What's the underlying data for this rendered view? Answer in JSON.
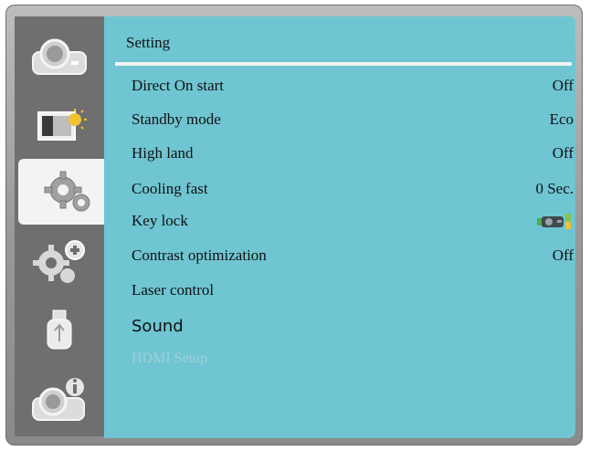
{
  "sidebar": {
    "items": [
      {
        "icon": "projector-icon"
      },
      {
        "icon": "image-adjust-icon"
      },
      {
        "icon": "settings-gears-icon",
        "active": true
      },
      {
        "icon": "advanced-settings-icon"
      },
      {
        "icon": "usb-icon"
      },
      {
        "icon": "projector-info-icon"
      }
    ]
  },
  "panel": {
    "title": "Setting",
    "rows": [
      {
        "label": "Direct On start",
        "value": "Off"
      },
      {
        "label": "Standby mode",
        "value": "Eco"
      },
      {
        "label": "High land",
        "value": "Off"
      },
      {
        "label": "Cooling fast",
        "value": "0 Sec."
      },
      {
        "label": "Key lock",
        "value": "",
        "value_icon": "key-lock-projector-icon"
      },
      {
        "label": "Contrast optimization",
        "value": "Off"
      },
      {
        "label": "Laser control",
        "value": ""
      },
      {
        "label": "Sound",
        "value": ""
      },
      {
        "label": "HDMI Setup",
        "value": "",
        "disabled": true
      }
    ]
  },
  "colors": {
    "panel": "#6fc5d2",
    "sidebar": "#6f6f6f",
    "active_tab": "#f3f3f3",
    "disabled_text": "#9fd1da"
  }
}
